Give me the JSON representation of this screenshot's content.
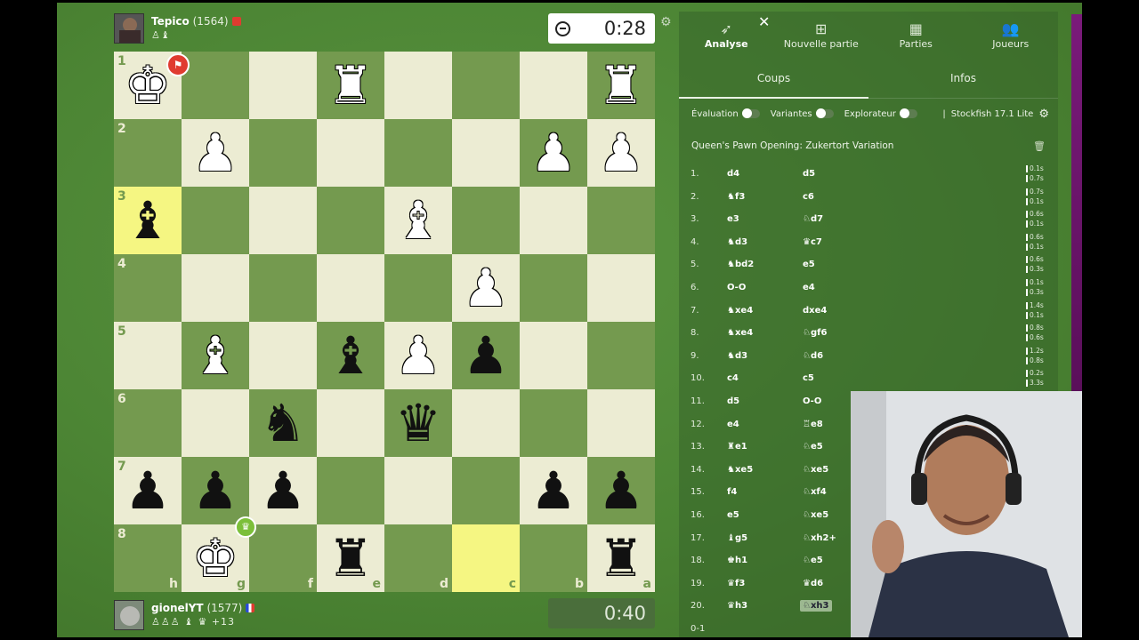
{
  "top_player": {
    "name": "Tepico",
    "rating": "(1564)",
    "captured": "♙♝"
  },
  "bottom_player": {
    "name": "gionelYT",
    "rating": "(1577)",
    "captured": "♙♙♙ ♝ ♛",
    "material": "+13"
  },
  "clocks": {
    "top": "0:28",
    "bottom": "0:40"
  },
  "colors": {
    "light_square": "#ececd3",
    "dark_square": "#749a4f",
    "highlight": "#f5f682",
    "flag_red": "#e03b30"
  },
  "board": {
    "ranks": [
      "1",
      "2",
      "3",
      "4",
      "5",
      "6",
      "7",
      "8"
    ],
    "files": [
      "h",
      "g",
      "f",
      "e",
      "d",
      "c",
      "b",
      "a"
    ],
    "pieces": [
      {
        "sq": "h1",
        "glyph": "♚",
        "side": "w"
      },
      {
        "sq": "e1",
        "glyph": "♜",
        "side": "w"
      },
      {
        "sq": "a1",
        "glyph": "♜",
        "side": "w"
      },
      {
        "sq": "g2",
        "glyph": "♟",
        "side": "w"
      },
      {
        "sq": "b2",
        "glyph": "♟",
        "side": "w"
      },
      {
        "sq": "a2",
        "glyph": "♟",
        "side": "w"
      },
      {
        "sq": "h3",
        "glyph": "♝",
        "side": "b"
      },
      {
        "sq": "d3",
        "glyph": "♝",
        "side": "w"
      },
      {
        "sq": "c4",
        "glyph": "♟",
        "side": "w"
      },
      {
        "sq": "g5",
        "glyph": "♝",
        "side": "w"
      },
      {
        "sq": "e5",
        "glyph": "♝",
        "side": "b"
      },
      {
        "sq": "d5",
        "glyph": "♟",
        "side": "w"
      },
      {
        "sq": "c5",
        "glyph": "♟",
        "side": "b"
      },
      {
        "sq": "f6",
        "glyph": "♞",
        "side": "b"
      },
      {
        "sq": "d6",
        "glyph": "♛",
        "side": "b"
      },
      {
        "sq": "h7",
        "glyph": "♟",
        "side": "b"
      },
      {
        "sq": "g7",
        "glyph": "♟",
        "side": "b"
      },
      {
        "sq": "f7",
        "glyph": "♟",
        "side": "b"
      },
      {
        "sq": "b7",
        "glyph": "♟",
        "side": "b"
      },
      {
        "sq": "a7",
        "glyph": "♟",
        "side": "b"
      },
      {
        "sq": "g8",
        "glyph": "♚",
        "side": "w"
      },
      {
        "sq": "e8",
        "glyph": "♜",
        "side": "b"
      },
      {
        "sq": "a8",
        "glyph": "♜",
        "side": "b"
      }
    ],
    "highlighted": [
      "h3",
      "c8"
    ]
  },
  "panel": {
    "tabs": [
      {
        "icon": "rocket-icon",
        "glyph": "➶",
        "label": "Analyse"
      },
      {
        "icon": "plus-icon",
        "glyph": "⊞",
        "label": "Nouvelle partie"
      },
      {
        "icon": "board-icon",
        "glyph": "▦",
        "label": "Parties"
      },
      {
        "icon": "users-icon",
        "glyph": "👥",
        "label": "Joueurs"
      }
    ],
    "subtabs": [
      "Coups",
      "Infos"
    ],
    "toggles": [
      "Évaluation",
      "Variantes",
      "Explorateur"
    ],
    "engine": "Stockfish 17.1 Lite",
    "opening": "Queen's Pawn Opening: Zukertort Variation",
    "moves": [
      {
        "n": "1.",
        "w": "d4",
        "b": "d5",
        "t1": "0.1s",
        "t2": "0.7s"
      },
      {
        "n": "2.",
        "w": "♞f3",
        "b": "c6",
        "t1": "0.7s",
        "t2": "0.1s"
      },
      {
        "n": "3.",
        "w": "e3",
        "b": "♘d7",
        "t1": "0.6s",
        "t2": "0.1s"
      },
      {
        "n": "4.",
        "w": "♞d3",
        "b": "♛c7",
        "t1": "0.6s",
        "t2": "0.1s"
      },
      {
        "n": "5.",
        "w": "♞bd2",
        "b": "e5",
        "t1": "0.6s",
        "t2": "0.3s"
      },
      {
        "n": "6.",
        "w": "O-O",
        "b": "e4",
        "t1": "0.1s",
        "t2": "0.3s"
      },
      {
        "n": "7.",
        "w": "♞xe4",
        "b": "dxe4",
        "t1": "1.4s",
        "t2": "0.1s"
      },
      {
        "n": "8.",
        "w": "♞xe4",
        "b": "♘gf6",
        "t1": "0.8s",
        "t2": "0.6s"
      },
      {
        "n": "9.",
        "w": "♞d3",
        "b": "♘d6",
        "t1": "1.2s",
        "t2": "0.8s"
      },
      {
        "n": "10.",
        "w": "c4",
        "b": "c5",
        "t1": "0.2s",
        "t2": "3.3s"
      },
      {
        "n": "11.",
        "w": "d5",
        "b": "O-O",
        "t1": "",
        "t2": ""
      },
      {
        "n": "12.",
        "w": "e4",
        "b": "♖e8",
        "t1": "",
        "t2": ""
      },
      {
        "n": "13.",
        "w": "♜e1",
        "b": "♘e5",
        "t1": "",
        "t2": ""
      },
      {
        "n": "14.",
        "w": "♞xe5",
        "b": "♘xe5",
        "t1": "",
        "t2": ""
      },
      {
        "n": "15.",
        "w": "f4",
        "b": "♘xf4",
        "t1": "",
        "t2": ""
      },
      {
        "n": "16.",
        "w": "e5",
        "b": "♘xe5",
        "t1": "",
        "t2": ""
      },
      {
        "n": "17.",
        "w": "♝g5",
        "b": "♘xh2+",
        "t1": "",
        "t2": ""
      },
      {
        "n": "18.",
        "w": "♚h1",
        "b": "♘e5",
        "t1": "",
        "t2": ""
      },
      {
        "n": "19.",
        "w": "♛f3",
        "b": "♛d6",
        "t1": "",
        "t2": ""
      },
      {
        "n": "20.",
        "w": "♛h3",
        "b": "♘xh3",
        "t1": "",
        "t2": ""
      }
    ],
    "result": "0-1"
  }
}
